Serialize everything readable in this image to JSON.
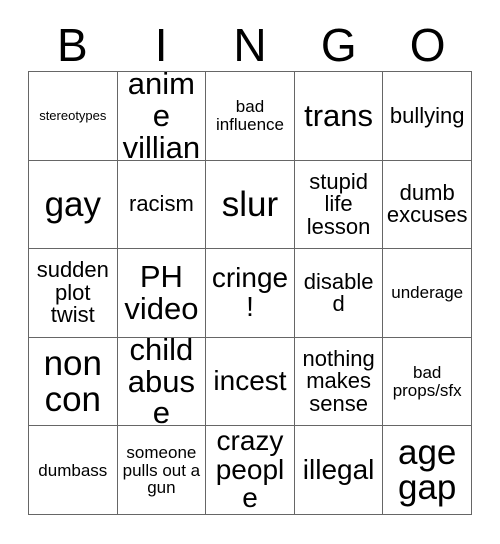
{
  "card": {
    "title": "BINGO",
    "header_letters": [
      "B",
      "I",
      "N",
      "G",
      "O"
    ],
    "grid_size": "5x5",
    "colors": {
      "background": "#ffffff",
      "cell_background": "#ffffff",
      "grid_line": "#666666",
      "text": "#000000"
    },
    "rows": [
      [
        {
          "label": "stereotypes",
          "size": "xxs"
        },
        {
          "label": "anime villian",
          "size": "xl"
        },
        {
          "label": "bad influence",
          "size": "sm"
        },
        {
          "label": "trans",
          "size": "xl"
        },
        {
          "label": "bullying",
          "size": "md"
        }
      ],
      [
        {
          "label": "gay",
          "size": "xxl"
        },
        {
          "label": "racism",
          "size": "md"
        },
        {
          "label": "slur",
          "size": "xxl"
        },
        {
          "label": "stupid life lesson",
          "size": "md"
        },
        {
          "label": "dumb excuses",
          "size": "md"
        }
      ],
      [
        {
          "label": "sudden plot twist",
          "size": "md"
        },
        {
          "label": "PH video",
          "size": "xl"
        },
        {
          "label": "cringe!",
          "size": "lg"
        },
        {
          "label": "disabled",
          "size": "md"
        },
        {
          "label": "underage",
          "size": "sm"
        }
      ],
      [
        {
          "label": "non con",
          "size": "xxl"
        },
        {
          "label": "child abuse",
          "size": "xl"
        },
        {
          "label": "incest",
          "size": "lg"
        },
        {
          "label": "nothing makes sense",
          "size": "md"
        },
        {
          "label": "bad props/sfx",
          "size": "sm"
        }
      ],
      [
        {
          "label": "dumbass",
          "size": "sm"
        },
        {
          "label": "someone pulls out a gun",
          "size": "sm"
        },
        {
          "label": "crazy people",
          "size": "lg"
        },
        {
          "label": "illegal",
          "size": "lg"
        },
        {
          "label": "age gap",
          "size": "xxl"
        }
      ]
    ]
  }
}
